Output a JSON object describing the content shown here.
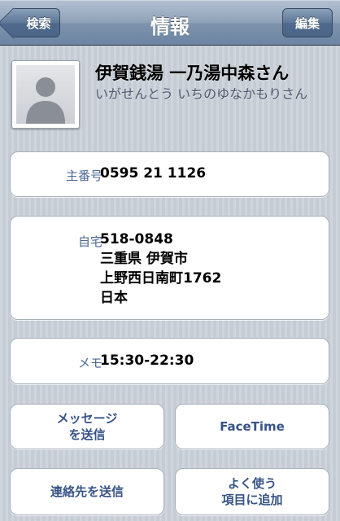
{
  "navbar": {
    "title": "情報",
    "back_label": "検索",
    "edit_label": "編集"
  },
  "contact": {
    "name": "伊賀銭湯 一乃湯中森さん",
    "reading": "いがせんとう いちのゆなかもりさん",
    "avatar_icon": "person-silhouette-icon"
  },
  "phone": {
    "label": "主番号",
    "value": "0595 21 1126"
  },
  "address": {
    "label": "自宅",
    "lines": [
      "518-0848",
      "三重県 伊賀市",
      "上野西日南町1762",
      "日本"
    ]
  },
  "memo": {
    "label": "メモ",
    "value": "15:30-22:30"
  },
  "actions": {
    "send_message": "メッセージ\nを送信",
    "facetime": "FaceTime",
    "share_contact": "連絡先を送信",
    "add_favorite": "よく使う\n項目に追加"
  }
}
